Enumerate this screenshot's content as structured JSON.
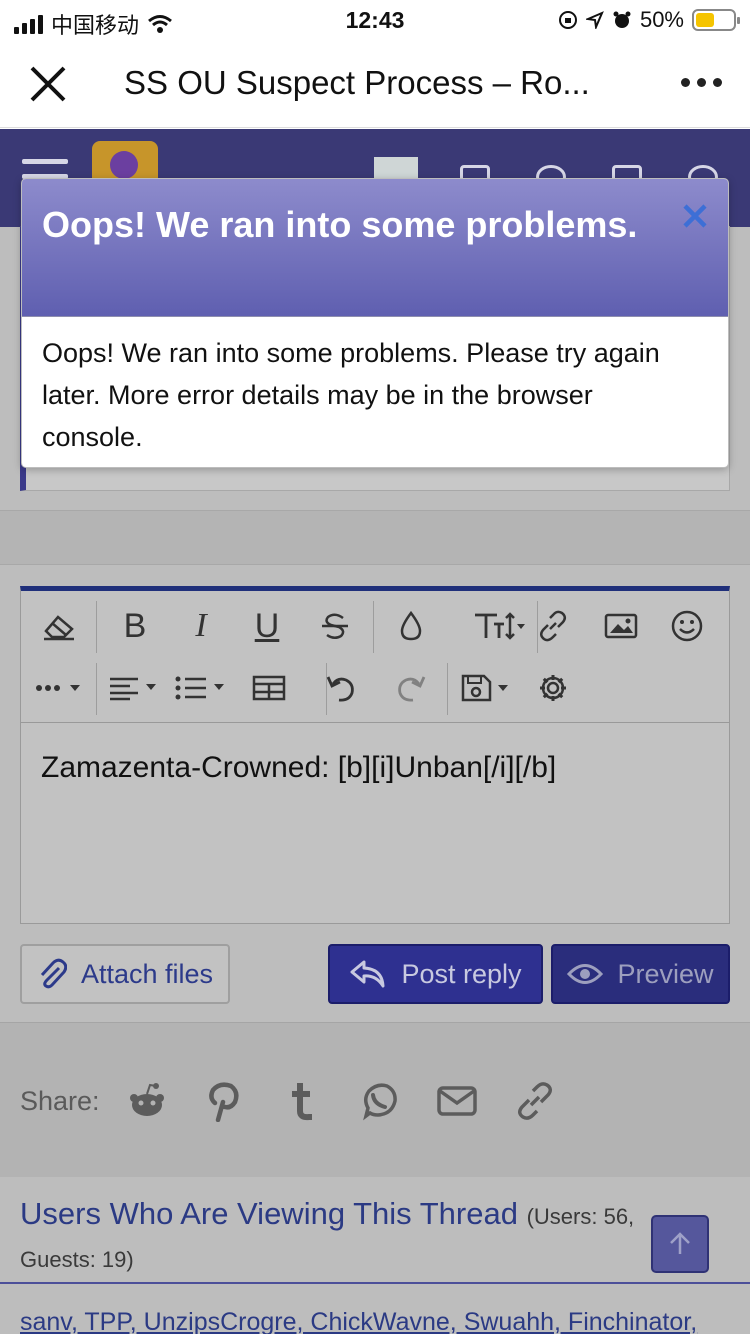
{
  "status_bar": {
    "carrier": "中国移动",
    "time": "12:43",
    "battery": "50%",
    "icons": [
      "signal-icon",
      "wifi-icon",
      "orientation-lock-icon",
      "location-icon",
      "alarm-icon",
      "battery-icon"
    ]
  },
  "nav_bar": {
    "title": "SS OU Suspect Process – Ro...",
    "close_icon": "close-icon",
    "more_icon": "more-icon"
  },
  "editor": {
    "toolbar_row1": [
      "eraser-icon",
      "B",
      "I",
      "U",
      "strikethrough-icon",
      "color-drop-icon",
      "text-size-icon",
      "link-icon",
      "image-icon",
      "smile-icon"
    ],
    "toolbar_row2": [
      "more-options-icon",
      "align-icon",
      "list-icon",
      "table-icon",
      "undo-icon",
      "redo-icon",
      "save-draft-icon",
      "settings-icon"
    ],
    "bold_label": "B",
    "italic_label": "I",
    "underline_label": "U",
    "content": "Zamazenta-Crowned: [b][i]Unban[/i][/b]"
  },
  "actions": {
    "attach_label": "Attach files",
    "post_label": "Post reply",
    "preview_label": "Preview"
  },
  "share": {
    "label": "Share:",
    "icons": [
      "reddit-icon",
      "pinterest-icon",
      "tumblr-icon",
      "whatsapp-icon",
      "email-icon",
      "link-icon"
    ]
  },
  "viewing": {
    "title": "Users Who Are Viewing This Thread",
    "count": "(Users: 56,",
    "guests": "Guests: 19)",
    "users": "sanv, TPP, UnzipsCrogre, ChickWavne, Swuahh, Finchinator,"
  },
  "modal": {
    "title": "Oops! We ran into some problems.",
    "body": "Oops! We ran into some problems. Please try again later. More error details may be in the browser console."
  },
  "colors": {
    "header_bg": "#3a3975",
    "modal_header": "#6d6cbc",
    "close_x": "#3d6fd6",
    "button_primary": "#2e3090",
    "link": "#2b3a84"
  }
}
